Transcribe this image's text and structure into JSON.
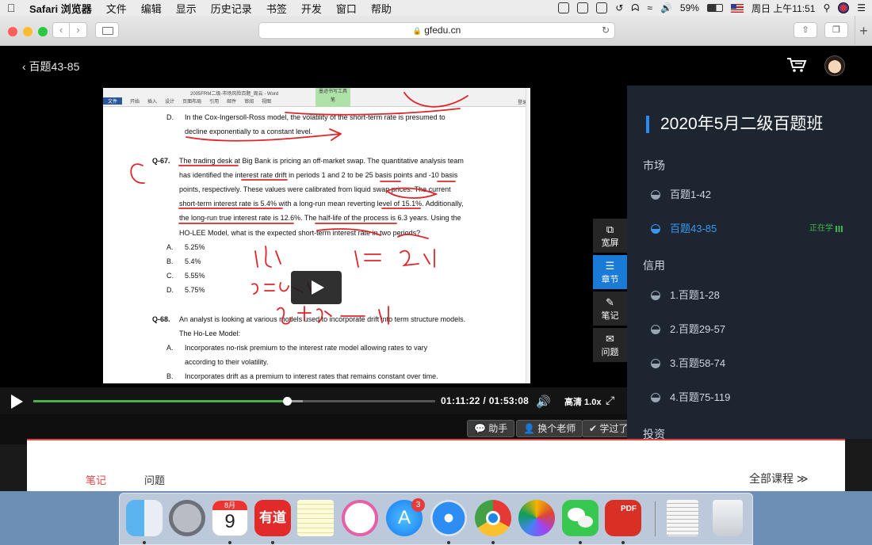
{
  "menubar": {
    "app_name": "Safari 浏览器",
    "items": [
      "文件",
      "编辑",
      "显示",
      "历史记录",
      "书签",
      "开发",
      "窗口",
      "帮助"
    ],
    "battery": "59%",
    "clock": "周日 上午11:51"
  },
  "browser": {
    "url": "gfedu.cn"
  },
  "page": {
    "back_label": "百题43-85",
    "document": {
      "window_title": "2005FRM二级-市场风险百题_周云 - Word",
      "ribbon_tabs": [
        "文件",
        "开始",
        "插入",
        "设计",
        "页面布局",
        "引用",
        "邮件",
        "审阅",
        "视图"
      ],
      "tool_label": "墨迹书写工具",
      "tool_sub": "笔",
      "signin": "登录",
      "line_d_prev": "In the Cox-Ingersoll-Ross model, the volatility of the short-term rate is presumed to",
      "line_d_prev_2": "decline exponentially to a constant level.",
      "q67_label": "Q-67.",
      "q67_lines": [
        "The trading desk at Big Bank is pricing an off-market swap. The quantitative analysis team",
        "has identified the interest rate drift in periods 1 and 2 to be 25 basis points and -10 basis",
        "points, respectively. These values were calibrated from liquid swap prices. The current",
        "short-term interest rate is 5.4% with a long-run mean reverting level of 15.1%. Additionally,",
        "the long-run true interest rate is 12.6%. The half-life of the process is 6.3 years. Using the",
        "HO-LEE Model, what is the expected short-term interest rate in two periods?"
      ],
      "q67_options": [
        {
          "letter": "A.",
          "text": "5.25%"
        },
        {
          "letter": "B.",
          "text": "5.4%"
        },
        {
          "letter": "C.",
          "text": "5.55%"
        },
        {
          "letter": "D.",
          "text": "5.75%"
        }
      ],
      "q68_label": "Q-68.",
      "q68_lines": [
        "An analyst is looking at various models used to incorporate drift into term structure models.",
        "The Ho-Lee Model:"
      ],
      "q68_options": [
        {
          "letter": "A.",
          "text": "Incorporates no-risk premium to the interest rate model allowing rates to vary"
        },
        {
          "letter": "",
          "text": "according to their volatility."
        },
        {
          "letter": "B.",
          "text": "Incorporates drift as a premium to interest rates that remains constant over time."
        }
      ]
    },
    "side_buttons": [
      {
        "label": "宽屏",
        "icon": "widescreen-icon"
      },
      {
        "label": "章节",
        "icon": "chapter-list-icon"
      },
      {
        "label": "笔记",
        "icon": "pencil-icon"
      },
      {
        "label": "问题",
        "icon": "question-icon"
      }
    ],
    "player": {
      "current_time": "01:11:22",
      "separator": "/",
      "duration": "01:53:08",
      "progress": 0.631,
      "buffered": 0.671,
      "quality": "高清 1.0x"
    },
    "actions": {
      "assistant": "助手",
      "switch_teacher": "换个老师",
      "learned": "学过了"
    },
    "course_panel": {
      "title": "2020年5月二级百题班",
      "sections": [
        {
          "name": "市场",
          "items": [
            {
              "label": "百题1-42",
              "current": false
            },
            {
              "label": "百题43-85",
              "current": true,
              "status": "正在学"
            }
          ]
        },
        {
          "name": "信用",
          "items": [
            {
              "label": "1.百题1-28",
              "current": false
            },
            {
              "label": "2.百题29-57",
              "current": false
            },
            {
              "label": "3.百题58-74",
              "current": false
            },
            {
              "label": "4.百题75-119",
              "current": false
            }
          ]
        },
        {
          "name": "投资",
          "items": []
        }
      ]
    },
    "bottom_tabs": {
      "notes": "笔记",
      "questions": "问题",
      "all_courses": "全部课程 ≫"
    }
  },
  "dock": {
    "calendar_month": "8月",
    "calendar_day": "9",
    "youdao": "有道",
    "appstore_badge": "3",
    "pdf_label": "PDF"
  },
  "colors": {
    "accent_blue": "#1a7bd6",
    "progress_green": "#49b24a",
    "panel_bg": "#1c2530",
    "ink_red": "#e0242b",
    "tab_red": "#e64545"
  }
}
